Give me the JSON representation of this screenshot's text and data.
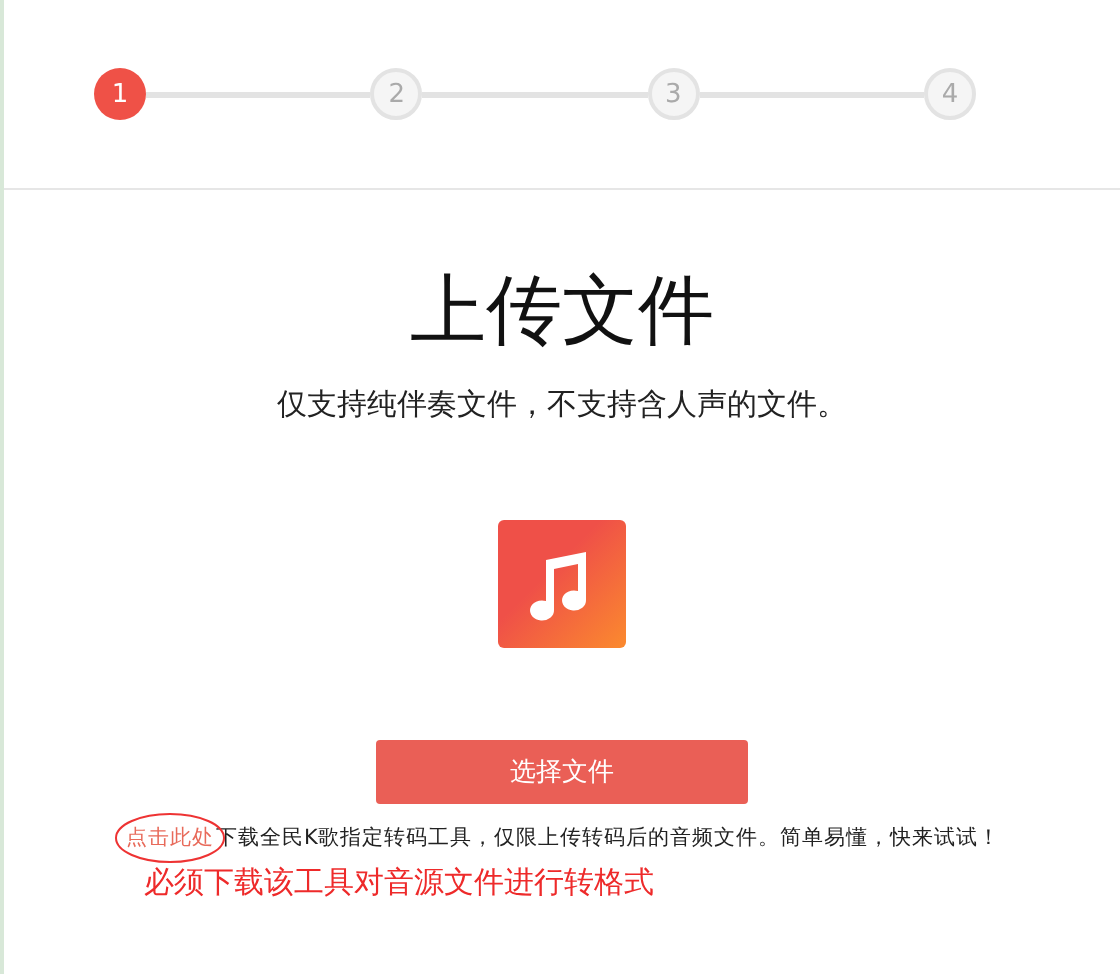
{
  "steps": [
    {
      "label": "1",
      "selected": true
    },
    {
      "label": "2",
      "selected": false
    },
    {
      "label": "3",
      "selected": false
    },
    {
      "label": "4",
      "selected": false
    }
  ],
  "title": "上传文件",
  "subtitle": "仅支持纯伴奏文件，不支持含人声的文件。",
  "button": "选择文件",
  "note": {
    "link": "点击此处",
    "text": "下载全民K歌指定转码工具，仅限上传转码后的音频文件。简单易懂，快来试试！"
  },
  "annotation": "必须下载该工具对音源文件进行转格式"
}
